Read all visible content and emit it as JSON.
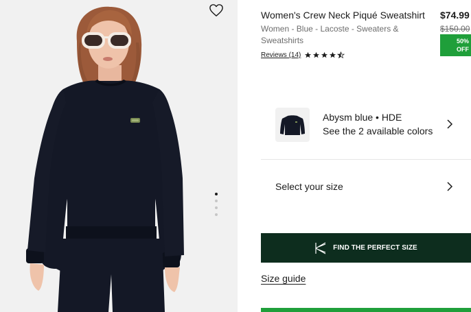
{
  "product": {
    "title": "Women's Crew Neck Piqué Sweatshirt",
    "price": "$74.99",
    "old_price": "$150.00",
    "discount_line1": "50%",
    "discount_line2": "OFF",
    "breadcrumb": "Women - Blue - Lacoste - Sweaters & Sweatshirts",
    "reviews_label": "Reviews (14)",
    "rating": 4.5
  },
  "colors": {
    "selected_name": "Abysm blue • HDE",
    "available_text": "See the 2 available colors"
  },
  "size": {
    "select_label": "Select your size",
    "find_button_label": "FIND THE PERFECT SIZE",
    "guide_label": "Size guide"
  },
  "gallery": {
    "dot_count": 4,
    "active_dot": 0
  },
  "theme": {
    "accent_green": "#1f9f3a",
    "dark_green": "#0d2d1e"
  }
}
